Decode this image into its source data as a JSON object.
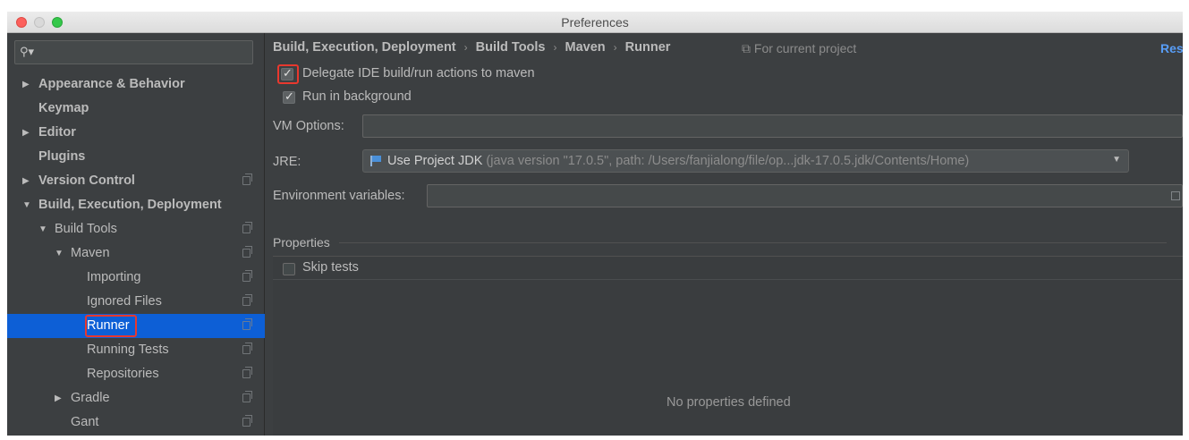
{
  "window": {
    "title": "Preferences"
  },
  "sidebar": {
    "search_placeholder": "",
    "items": [
      {
        "label": "Appearance & Behavior",
        "arrow": "▶"
      },
      {
        "label": "Keymap"
      },
      {
        "label": "Editor",
        "arrow": "▶"
      },
      {
        "label": "Plugins"
      },
      {
        "label": "Version Control",
        "arrow": "▶"
      },
      {
        "label": "Build, Execution, Deployment",
        "arrow": "▼"
      },
      {
        "label": "Build Tools",
        "arrow": "▼"
      },
      {
        "label": "Maven",
        "arrow": "▼"
      },
      {
        "label": "Importing"
      },
      {
        "label": "Ignored Files"
      },
      {
        "label": "Runner",
        "selected": true
      },
      {
        "label": "Running Tests"
      },
      {
        "label": "Repositories"
      },
      {
        "label": "Gradle",
        "arrow": "▶"
      },
      {
        "label": "Gant"
      }
    ]
  },
  "main": {
    "breadcrumb": [
      "Build, Execution, Deployment",
      "Build Tools",
      "Maven",
      "Runner"
    ],
    "breadcrumb_sep": "›",
    "scope_label": "For current project",
    "reset_label": "Res",
    "delegate_checkbox": {
      "label": "Delegate IDE build/run actions to maven",
      "checked": true
    },
    "background_checkbox": {
      "label": "Run in background",
      "checked": true
    },
    "vm_options": {
      "label": "VM Options:",
      "value": ""
    },
    "jre": {
      "label": "JRE:",
      "selected": "Use Project JDK",
      "detail": "(java version \"17.0.5\", path: /Users/fanjialong/file/op...jdk-17.0.5.jdk/Contents/Home)"
    },
    "env_vars": {
      "label": "Environment variables:",
      "value": ""
    },
    "properties": {
      "title": "Properties",
      "skip_tests": {
        "label": "Skip tests",
        "checked": false
      },
      "empty_text": "No properties defined"
    }
  },
  "colors": {
    "background": "#3c3f41",
    "selection": "#0d5fd6",
    "highlight_box": "#e8382e",
    "link": "#589df6"
  }
}
